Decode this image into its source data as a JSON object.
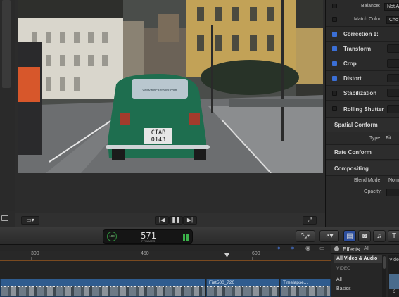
{
  "inspector": {
    "balance": {
      "label": "Balance:",
      "value": "Not Ar"
    },
    "match_color": {
      "label": "Match Color:",
      "value": "Cho"
    },
    "correction": "Correction 1:",
    "transform": "Transform",
    "crop": "Crop",
    "distort": "Distort",
    "stabilization": "Stabilization",
    "rolling_shutter": "Rolling Shutter",
    "spatial_conform": {
      "label": "Spatial Conform",
      "type_label": "Type:",
      "type_value": "Fit"
    },
    "rate_conform": "Rate Conform",
    "compositing": {
      "label": "Compositing",
      "blend_label": "Blend Mode:",
      "blend_value": "Norma",
      "opacity_label": "Opacity:"
    }
  },
  "video": {
    "plate": "CIAB 0143",
    "window_text": "www.tuscantours.com"
  },
  "viewer_bar": {
    "prev": "|◀",
    "pause": "❚❚",
    "next": "▶|"
  },
  "timecode": {
    "value": "571",
    "unit": "FRAMES",
    "percent": "100"
  },
  "timeline": {
    "ruler_labels": [
      {
        "text": "300",
        "frame": 300
      },
      {
        "text": "450",
        "frame": 450
      },
      {
        "text": "600",
        "frame": 600
      }
    ],
    "clips": [
      {
        "title": "",
        "name": "clip-1"
      },
      {
        "title": "Fiat500_720",
        "name": "clip-fiat500"
      },
      {
        "title": "Timelapse...",
        "name": "clip-timelapse"
      }
    ]
  },
  "effects": {
    "title": "Effects",
    "all_label": "All",
    "items": [
      "All Video & Audio",
      "VIDEO",
      "All",
      "Basics"
    ],
    "thumb_label": "Vide",
    "thumb_count": "3"
  },
  "colors": {
    "accent_blue": "#3b6fd6",
    "timecode_green": "#3bb24a",
    "clip_blue": "#2f5c8f"
  }
}
